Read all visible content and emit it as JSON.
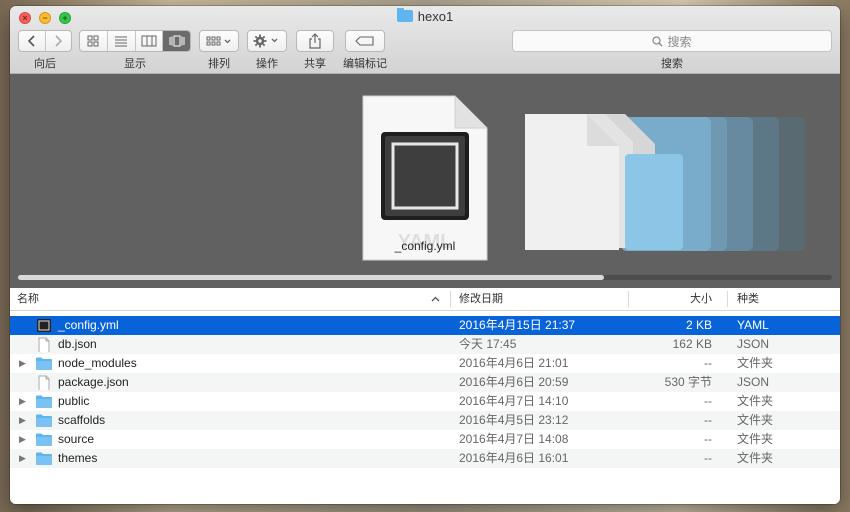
{
  "window": {
    "title": "hexo1"
  },
  "toolbar": {
    "back_label": "向后",
    "view_label": "显示",
    "arrange_label": "排列",
    "action_label": "操作",
    "share_label": "共享",
    "tags_label": "编辑标记",
    "search_label": "搜索",
    "search_placeholder": "搜索"
  },
  "preview": {
    "file_name": "_config.yml",
    "file_type_watermark": "YAML",
    "scroll_position": 0.72
  },
  "columns": {
    "name": "名称",
    "date": "修改日期",
    "size": "大小",
    "kind": "种类"
  },
  "files": [
    {
      "name": "_config.yml",
      "date": "2016年4月15日 21:37",
      "size": "2 KB",
      "kind": "YAML",
      "icon": "terminal-file-icon",
      "selected": true,
      "folder": false
    },
    {
      "name": "db.json",
      "date": "今天 17:45",
      "size": "162 KB",
      "kind": "JSON",
      "icon": "document-icon",
      "selected": false,
      "folder": false
    },
    {
      "name": "node_modules",
      "date": "2016年4月6日 21:01",
      "size": "--",
      "kind": "文件夹",
      "icon": "folder-icon",
      "selected": false,
      "folder": true
    },
    {
      "name": "package.json",
      "date": "2016年4月6日 20:59",
      "size": "530 字节",
      "kind": "JSON",
      "icon": "document-icon",
      "selected": false,
      "folder": false
    },
    {
      "name": "public",
      "date": "2016年4月7日 14:10",
      "size": "--",
      "kind": "文件夹",
      "icon": "folder-icon",
      "selected": false,
      "folder": true
    },
    {
      "name": "scaffolds",
      "date": "2016年4月5日 23:12",
      "size": "--",
      "kind": "文件夹",
      "icon": "folder-icon",
      "selected": false,
      "folder": true
    },
    {
      "name": "source",
      "date": "2016年4月7日 14:08",
      "size": "--",
      "kind": "文件夹",
      "icon": "folder-icon",
      "selected": false,
      "folder": true
    },
    {
      "name": "themes",
      "date": "2016年4月6日 16:01",
      "size": "--",
      "kind": "文件夹",
      "icon": "folder-icon",
      "selected": false,
      "folder": true
    }
  ],
  "colors": {
    "selection": "#0863d8",
    "folder": "#5fb5f0"
  }
}
